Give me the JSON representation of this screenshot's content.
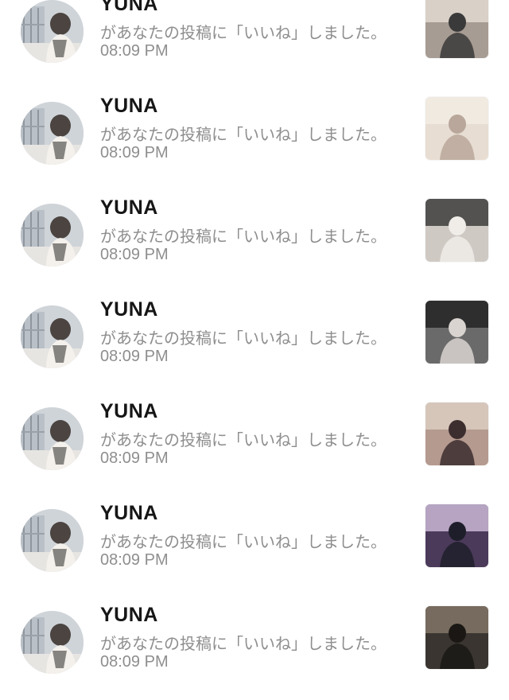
{
  "notifications": [
    {
      "username": "YUNA",
      "message": "があなたの投稿に「いいね」しました。",
      "time": "08:09 PM",
      "thumb_colors": [
        "#a79c93",
        "#e9e2da",
        "#3a3a3a"
      ]
    },
    {
      "username": "YUNA",
      "message": "があなたの投稿に「いいね」しました。",
      "time": "08:09 PM",
      "thumb_colors": [
        "#e8ddd2",
        "#f3ede6",
        "#b8a79a"
      ]
    },
    {
      "username": "YUNA",
      "message": "があなたの投稿に「いいね」しました。",
      "time": "08:09 PM",
      "thumb_colors": [
        "#cfc9c4",
        "#2a2a2a",
        "#f0ece8"
      ]
    },
    {
      "username": "YUNA",
      "message": "があなたの投稿に「いいね」しました。",
      "time": "08:09 PM",
      "thumb_colors": [
        "#6a6a6a",
        "#1b1b1b",
        "#d9d4d0"
      ]
    },
    {
      "username": "YUNA",
      "message": "があなたの投稿に「いいね」しました。",
      "time": "08:09 PM",
      "thumb_colors": [
        "#b59a8f",
        "#e2d4c8",
        "#3c2d2f"
      ]
    },
    {
      "username": "YUNA",
      "message": "があなたの投稿に「いいね」しました。",
      "time": "08:09 PM",
      "thumb_colors": [
        "#4b3a5a",
        "#d9c8e6",
        "#1e1e2a"
      ]
    },
    {
      "username": "YUNA",
      "message": "があなたの投稿に「いいね」しました。",
      "time": "08:09 PM",
      "thumb_colors": [
        "#3a3530",
        "#8b7d6e",
        "#1a1714"
      ]
    }
  ]
}
